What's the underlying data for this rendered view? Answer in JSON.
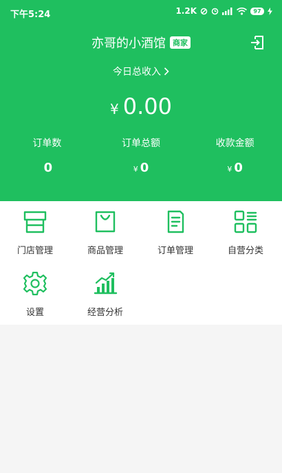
{
  "status_bar": {
    "time": "下午5:24",
    "net_speed": "1.2K",
    "battery": "97"
  },
  "header": {
    "shop_name": "亦哥的小酒馆",
    "badge": "商家",
    "income_link": "今日总收入",
    "currency": "¥",
    "total_amount": "0.00"
  },
  "stats": [
    {
      "label": "订单数",
      "value": "0",
      "currency": ""
    },
    {
      "label": "订单总额",
      "value": "0",
      "currency": "¥"
    },
    {
      "label": "收款金额",
      "value": "0",
      "currency": "¥"
    }
  ],
  "menu": [
    {
      "label": "门店管理",
      "icon": "store-icon"
    },
    {
      "label": "商品管理",
      "icon": "shopping-bag-icon"
    },
    {
      "label": "订单管理",
      "icon": "order-document-icon"
    },
    {
      "label": "自营分类",
      "icon": "category-grid-icon"
    },
    {
      "label": "设置",
      "icon": "gear-icon"
    },
    {
      "label": "经营分析",
      "icon": "bar-chart-icon"
    }
  ],
  "colors": {
    "brand_green": "#1fbf5f",
    "icon_green": "#1fbf5f"
  }
}
